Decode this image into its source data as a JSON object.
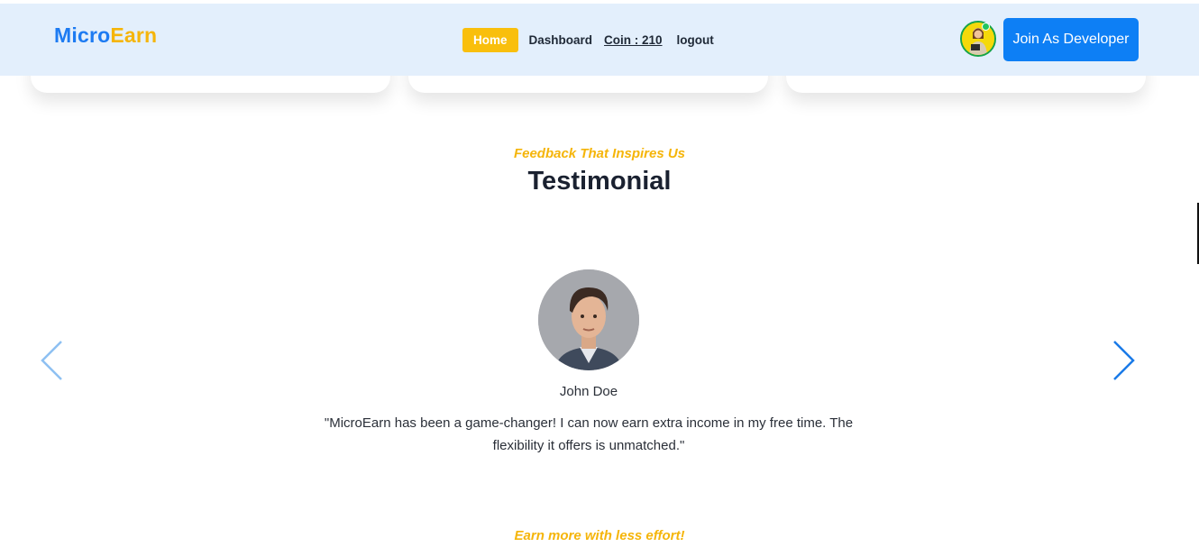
{
  "header": {
    "logo_part1": "Micro",
    "logo_part2": "Earn",
    "nav": {
      "home": "Home",
      "dashboard": "Dashboard",
      "coin": "Coin : 210",
      "logout": "logout"
    },
    "join_button": "Join As Developer"
  },
  "testimonial": {
    "eyebrow": "Feedback That Inspires Us",
    "title": "Testimonial",
    "name": "John Doe",
    "quote": "\"MicroEarn has been a game-changer! I can now earn extra income in my free time. The flexibility it offers is unmatched.\""
  },
  "next_section": {
    "eyebrow": "Earn more with less effort!"
  },
  "colors": {
    "brand_blue": "#1d7bf2",
    "brand_yellow": "#f5b50a",
    "header_bg": "#e3effc",
    "button_blue": "#0d7ff5"
  }
}
